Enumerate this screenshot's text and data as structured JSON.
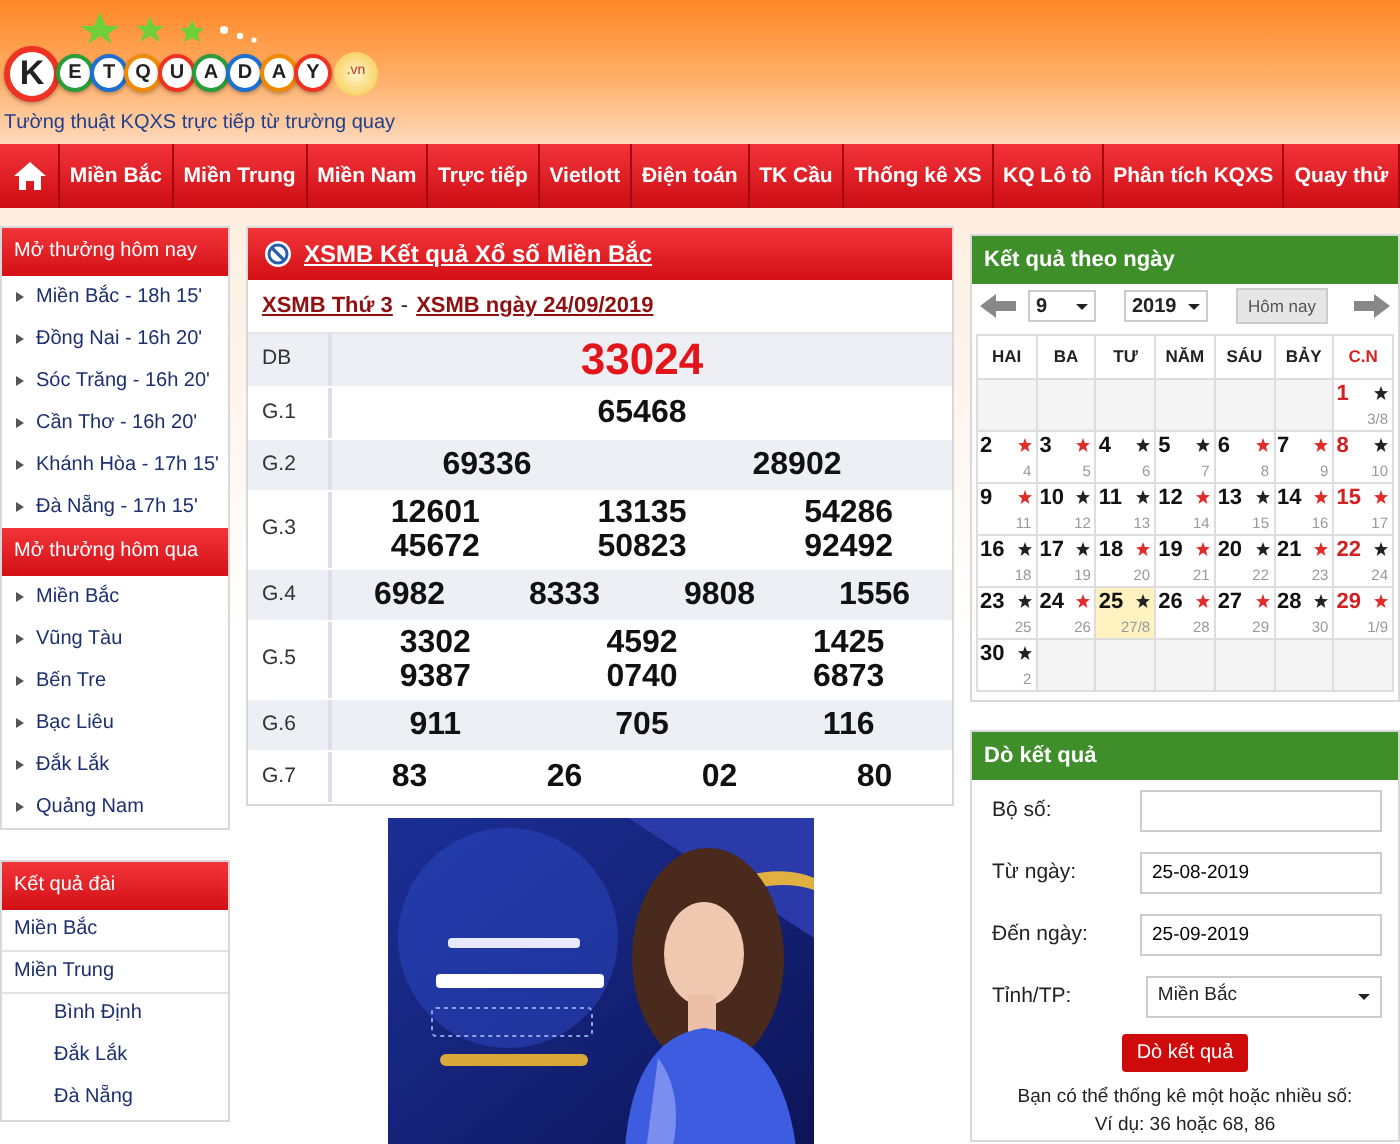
{
  "logo": {
    "letters": [
      "K",
      "E",
      "T",
      "Q",
      "U",
      "A",
      "D",
      "A",
      "Y"
    ],
    "suffix": ".vn",
    "tagline": "Tường thuật KQXS trực tiếp từ trường quay"
  },
  "nav": {
    "items": [
      "Miền Bắc",
      "Miền Trung",
      "Miền Nam",
      "Trực tiếp",
      "Vietlott",
      "Điện toán",
      "TK Cầu",
      "Thống kê XS",
      "KQ Lô tô",
      "Phân tích KQXS",
      "Quay thử"
    ]
  },
  "sidebar": {
    "today": {
      "title": "Mở thưởng hôm nay",
      "items": [
        "Miền Bắc - 18h 15'",
        "Đồng Nai - 16h 20'",
        "Sóc Trăng - 16h 20'",
        "Cần Thơ - 16h 20'",
        "Khánh Hòa - 17h 15'",
        "Đà Nẵng - 17h 15'"
      ]
    },
    "yesterday": {
      "title": "Mở thưởng hôm qua",
      "items": [
        "Miền Bắc",
        "Vũng Tàu",
        "Bến Tre",
        "Bạc Liêu",
        "Đắk Lắk",
        "Quảng Nam"
      ]
    },
    "stations": {
      "title": "Kết quả đài",
      "items": [
        {
          "label": "Miền Bắc"
        },
        {
          "label": "Miền Trung",
          "children": [
            {
              "label": "Bình Định"
            },
            {
              "label": "Đắk Lắk"
            },
            {
              "label": "Đà Nẵng"
            }
          ]
        }
      ]
    }
  },
  "results": {
    "title": "XSMB Kết quả Xổ số Miền Bắc",
    "links": [
      "XSMB Thứ 3",
      "XSMB ngày 24/09/2019"
    ],
    "separator": "-",
    "rows": [
      {
        "label": "DB",
        "kind": "special",
        "numbers": [
          "33024"
        ]
      },
      {
        "label": "G.1",
        "kind": "normal",
        "numbers": [
          "65468"
        ]
      },
      {
        "label": "G.2",
        "kind": "normal",
        "numbers": [
          "69336",
          "28902"
        ]
      },
      {
        "label": "G.3",
        "kind": "normal",
        "numbers": [
          "12601",
          "13135",
          "54286",
          "45672",
          "50823",
          "92492"
        ]
      },
      {
        "label": "G.4",
        "kind": "normal",
        "numbers": [
          "6982",
          "8333",
          "9808",
          "1556"
        ]
      },
      {
        "label": "G.5",
        "kind": "normal",
        "numbers": [
          "3302",
          "4592",
          "1425",
          "9387",
          "0740",
          "6873"
        ]
      },
      {
        "label": "G.6",
        "kind": "normal",
        "numbers": [
          "911",
          "705",
          "116"
        ]
      },
      {
        "label": "G.7",
        "kind": "normal",
        "numbers": [
          "83",
          "26",
          "02",
          "80"
        ]
      }
    ]
  },
  "calendar": {
    "title": "Kết quả theo ngày",
    "month": "9",
    "year": "2019",
    "today_button": "Hôm nay",
    "weekdays": [
      "HAI",
      "BA",
      "TƯ",
      "NĂM",
      "SÁU",
      "BẢY",
      "C.N"
    ],
    "weeks": [
      [
        {
          "day": "1",
          "lunar": "3/8",
          "color": "#222222",
          "selected": false
        }
      ],
      [
        {
          "day": "2",
          "lunar": "4",
          "color": "#e02b2b",
          "selected": false
        },
        {
          "day": "3",
          "lunar": "5",
          "color": "#e02b2b",
          "selected": false
        },
        {
          "day": "4",
          "lunar": "6",
          "color": "#222222",
          "selected": false
        },
        {
          "day": "5",
          "lunar": "7",
          "color": "#222222",
          "selected": false
        },
        {
          "day": "6",
          "lunar": "8",
          "color": "#e02b2b",
          "selected": false
        },
        {
          "day": "7",
          "lunar": "9",
          "color": "#e02b2b",
          "selected": false
        },
        {
          "day": "8",
          "lunar": "10",
          "color": "#222222",
          "selected": false
        }
      ],
      [
        {
          "day": "9",
          "lunar": "11",
          "color": "#e02b2b",
          "selected": false
        },
        {
          "day": "10",
          "lunar": "12",
          "color": "#222222",
          "selected": false
        },
        {
          "day": "11",
          "lunar": "13",
          "color": "#222222",
          "selected": false
        },
        {
          "day": "12",
          "lunar": "14",
          "color": "#e02b2b",
          "selected": false
        },
        {
          "day": "13",
          "lunar": "15",
          "color": "#222222",
          "selected": false
        },
        {
          "day": "14",
          "lunar": "16",
          "color": "#e02b2b",
          "selected": false
        },
        {
          "day": "15",
          "lunar": "17",
          "color": "#e02b2b",
          "selected": false
        }
      ],
      [
        {
          "day": "16",
          "lunar": "18",
          "color": "#222222",
          "selected": false
        },
        {
          "day": "17",
          "lunar": "19",
          "color": "#222222",
          "selected": false
        },
        {
          "day": "18",
          "lunar": "20",
          "color": "#e02b2b",
          "selected": false
        },
        {
          "day": "19",
          "lunar": "21",
          "color": "#e02b2b",
          "selected": false
        },
        {
          "day": "20",
          "lunar": "22",
          "color": "#222222",
          "selected": false
        },
        {
          "day": "21",
          "lunar": "23",
          "color": "#e02b2b",
          "selected": false
        },
        {
          "day": "22",
          "lunar": "24",
          "color": "#222222",
          "selected": false
        }
      ],
      [
        {
          "day": "23",
          "lunar": "25",
          "color": "#222222",
          "selected": false
        },
        {
          "day": "24",
          "lunar": "26",
          "color": "#e02b2b",
          "selected": false
        },
        {
          "day": "25",
          "lunar": "27/8",
          "color": "#222222",
          "selected": true
        },
        {
          "day": "26",
          "lunar": "28",
          "color": "#e02b2b",
          "selected": false
        },
        {
          "day": "27",
          "lunar": "29",
          "color": "#e02b2b",
          "selected": false
        },
        {
          "day": "28",
          "lunar": "30",
          "color": "#222222",
          "selected": false
        },
        {
          "day": "29",
          "lunar": "1/9",
          "color": "#e02b2b",
          "selected": false
        }
      ],
      [
        {
          "day": "30",
          "lunar": "2",
          "color": "#222222",
          "selected": false
        }
      ]
    ]
  },
  "search": {
    "title": "Dò kết quả",
    "fields": [
      {
        "label": "Bộ số:",
        "kind": "input"
      },
      {
        "label": "Từ ngày:",
        "kind": "input",
        "value": "25-08-2019"
      },
      {
        "label": "Đến ngày:",
        "kind": "input",
        "value": "25-09-2019"
      },
      {
        "label": "Tỉnh/TP:",
        "kind": "select",
        "value": "Miền Bắc"
      }
    ],
    "button": "Dò kết quả",
    "notes": [
      "Bạn có thể thống kê một hoặc nhiều số:",
      "Ví dụ: 36 hoặc 68, 86"
    ]
  }
}
